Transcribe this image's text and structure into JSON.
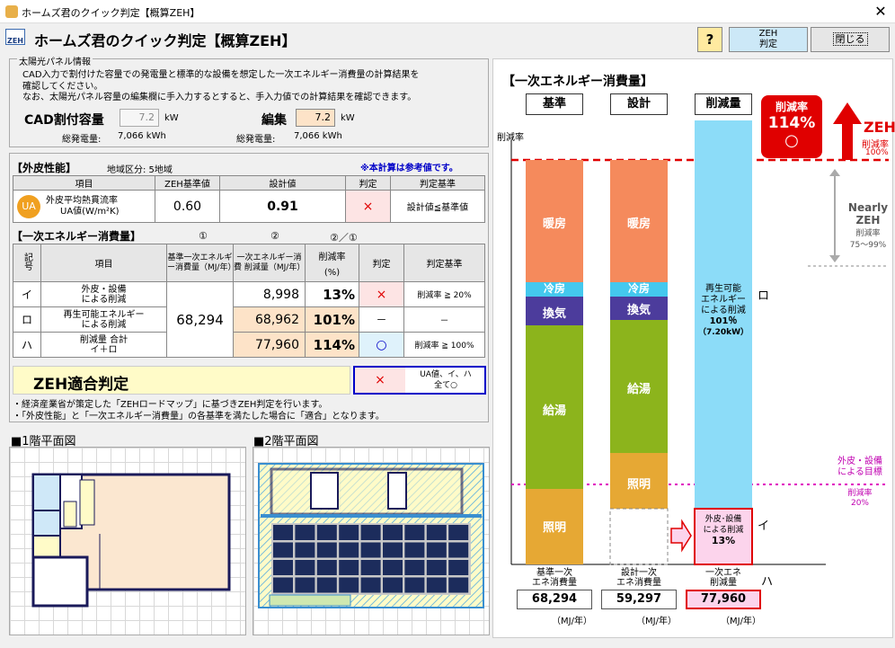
{
  "window": {
    "title": "ホームズ君のクイック判定【概算ZEH】",
    "close_glyph": "✕"
  },
  "header": {
    "title": "ホームズ君のクイック判定【概算ZEH】",
    "logo_text": "ZEH",
    "help_label": "?",
    "zeh_btn_l1": "ZEH",
    "zeh_btn_l2": "判定",
    "close_label": "閉じる"
  },
  "solar": {
    "legend": "太陽光パネル情報",
    "desc1": "CAD入力で割付けた容量での発電量と標準的な設備を想定した一次エネルギー消費量の計算結果を",
    "desc2": "確認してください。",
    "desc3": "なお、太陽光パネル容量の編集欄に手入力するとすると、手入力値での計算結果を確認できます。",
    "cad_label": "CAD割付容量",
    "cad_value": "7.2",
    "kw": "kW",
    "total_label": "総発電量:",
    "cad_total": "7,066 kWh",
    "edit_label": "編集",
    "edit_value": "7.2",
    "edit_total": "7,066 kWh"
  },
  "envelope": {
    "heading": "【外皮性能】",
    "region": "地域区分: 5地域",
    "note": "※本計算は参考値です。",
    "cols": [
      "項目",
      "ZEH基準値",
      "設計値",
      "判定",
      "判定基準"
    ],
    "ua_icon": "UA",
    "ua_item1": "外皮平均熱貫流率",
    "ua_item2": "UA値(W/m²K)",
    "ua_std": "0.60",
    "ua_design": "0.91",
    "ua_judge": "×",
    "ua_criteria": "設計値≦基準値"
  },
  "energy": {
    "heading": "【一次エネルギー消費量】",
    "c1": "①",
    "c2": "②",
    "c3": "②／①",
    "h_sym": "記号",
    "h_item": "項目",
    "h_base": "基準一次エネルギー消費量（MJ/年）",
    "h_design": "一次エネルギー消費 削減量（MJ/年）",
    "h_rate1": "削減率",
    "h_rate2": "(%)",
    "h_judge": "判定",
    "h_crit": "判定基準",
    "base_value": "68,294",
    "rows": [
      {
        "sym": "イ",
        "item1": "外皮・設備",
        "item2": "による削減",
        "design": "8,998",
        "rate": "13%",
        "judge": "×",
        "crit": "削減率 ≧ 20%"
      },
      {
        "sym": "ロ",
        "item1": "再生可能エネルギー",
        "item2": "による削減",
        "design": "68,962",
        "rate": "101%",
        "judge": "－",
        "crit": "－"
      },
      {
        "sym": "ハ",
        "item1": "削減量 合計",
        "item2": "イ＋ロ",
        "design": "77,960",
        "rate": "114%",
        "judge": "○",
        "crit": "削減率 ≧ 100%"
      }
    ]
  },
  "zeh_judge": {
    "label": "ZEH適合判定",
    "result": "×",
    "cond1": "UA値、イ、ハ",
    "cond2": "全て○"
  },
  "notes": [
    "・経済産業省が策定した「ZEHロードマップ」に基づきZEH判定を行います。",
    "・「外皮性能」と「一次エネルギー消費量」の各基準を満たした場合に「適合」となります。"
  ],
  "plans": {
    "floor1": "■1階平面図",
    "floor2": "■2階平面図"
  },
  "chart_data": {
    "type": "bar",
    "title": "【一次エネルギー消費量】",
    "ylabel": "削減率",
    "categories": [
      "基準",
      "設計",
      "削減量"
    ],
    "series": [
      {
        "name": "暖房",
        "values": [
          null,
          null,
          null
        ]
      },
      {
        "name": "冷房",
        "values": [
          null,
          null,
          null
        ]
      },
      {
        "name": "換気",
        "values": [
          null,
          null,
          null
        ]
      },
      {
        "name": "給湯",
        "values": [
          null,
          null,
          null
        ]
      },
      {
        "name": "照明",
        "values": [
          null,
          null,
          null
        ]
      }
    ],
    "reduction_rate_label": "削減率",
    "reduction_rate": "114%",
    "reduction_mark": "○",
    "zeh_label": "ZEH",
    "zeh_sub1": "削減率",
    "zeh_sub2": "100%",
    "nearly_1": "Nearly",
    "nearly_2": "ZEH",
    "nearly_3": "削減率",
    "nearly_4": "75～99%",
    "renew_1": "再生可能",
    "renew_2": "エネルギー",
    "renew_3": "による削減",
    "renew_4": "101％",
    "renew_5": "（7.20kW）",
    "renew_sym": "ロ",
    "env_1": "外皮･設備",
    "env_2": "による削減",
    "env_3": "13%",
    "env_sym": "イ",
    "target_1": "外皮・設備",
    "target_2": "による目標",
    "target_3": "削減率",
    "target_4": "20%",
    "total_sym": "ハ",
    "foot": [
      {
        "l1": "基準一次",
        "l2": "エネ消費量",
        "value": "68,294",
        "unit": "（MJ/年）"
      },
      {
        "l1": "設計一次",
        "l2": "エネ消費量",
        "value": "59,297",
        "unit": "（MJ/年）"
      },
      {
        "l1": "一次エネ",
        "l2": "削減量",
        "value": "77,960",
        "unit": "（MJ/年）"
      }
    ]
  }
}
